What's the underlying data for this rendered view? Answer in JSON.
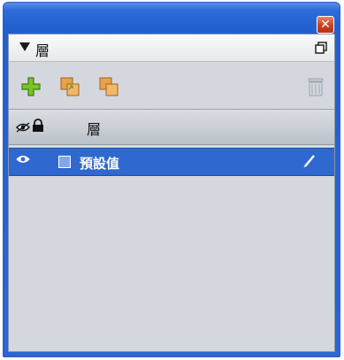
{
  "window": {
    "close_label": "✕"
  },
  "panel": {
    "title": "層"
  },
  "layers_header": {
    "label": "層"
  },
  "layers": [
    {
      "name": "預設值",
      "selected": true,
      "swatch_color": "#7fa8ef"
    }
  ],
  "icons": {
    "add": "plus-icon",
    "merge": "merge-layers-icon",
    "duplicate": "duplicate-layer-icon",
    "delete": "trash-icon",
    "visibility": "eye-icon",
    "lock": "lock-icon",
    "edit": "pencil-icon",
    "restore": "restore-icon"
  },
  "colors": {
    "title_bar": "#235fcf",
    "close": "#c8401f",
    "selected_row": "#2f68cf",
    "panel_bg": "#d4d8de",
    "add_green": "#6ab51e",
    "tool_orange": "#e08a3c"
  }
}
